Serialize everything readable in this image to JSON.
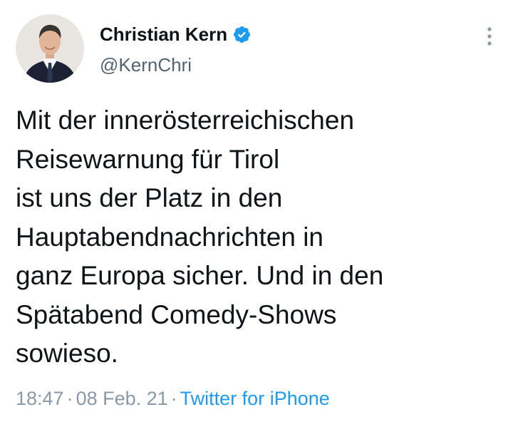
{
  "author": {
    "display_name": "Christian Kern",
    "handle": "@KernChri",
    "verified": true,
    "avatar_icon": "profile-photo"
  },
  "menu_icon": "more-vertical-icon",
  "tweet": {
    "lines": [
      "Mit der innerösterreichischen",
      "Reisewarnung für Tirol",
      "ist uns der Platz in den",
      "Hauptabendnachrichten in",
      "ganz Europa sicher. Und in den",
      "Spätabend Comedy-Shows",
      "sowieso."
    ]
  },
  "meta": {
    "time": "18:47",
    "separator": "·",
    "date": "08 Feb. 21",
    "source": "Twitter for iPhone"
  },
  "colors": {
    "text": "#0f1419",
    "secondary": "#536471",
    "meta": "#8b98a5",
    "link": "#1d9bf0",
    "verified": "#1d9bf0"
  }
}
